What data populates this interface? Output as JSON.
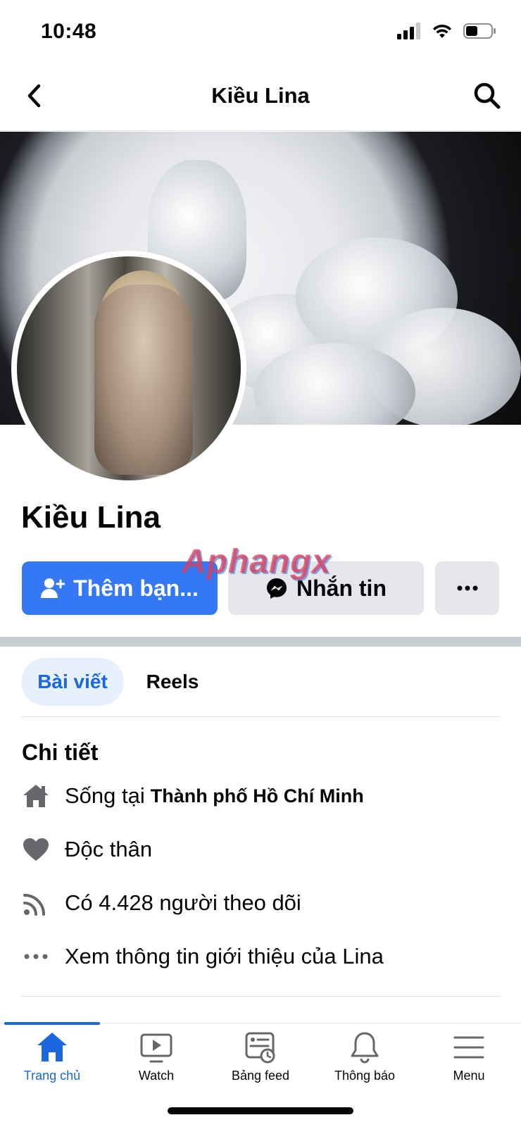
{
  "status_bar": {
    "time": "10:48"
  },
  "nav": {
    "title": "Kiều Lina"
  },
  "profile": {
    "name": "Kiều Lina"
  },
  "actions": {
    "add_friend_label": "Thêm bạn...",
    "message_label": "Nhắn tin",
    "more_label": "···"
  },
  "watermark": "Aphangx",
  "tabs": [
    {
      "label": "Bài viết",
      "active": true
    },
    {
      "label": "Reels",
      "active": false
    }
  ],
  "details": {
    "title": "Chi tiết",
    "lives_prefix": "Sống tại",
    "lives_city": "Thành phố Hồ Chí Minh",
    "relationship": "Độc thân",
    "followers": "Có 4.428 người theo dõi",
    "see_about": "Xem thông tin giới thiệu của Lina"
  },
  "tab_bar": [
    {
      "label": "Trang chủ",
      "icon": "home-icon",
      "active": true
    },
    {
      "label": "Watch",
      "icon": "watch-icon",
      "active": false
    },
    {
      "label": "Bảng feed",
      "icon": "feed-icon",
      "active": false
    },
    {
      "label": "Thông báo",
      "icon": "bell-icon",
      "active": false
    },
    {
      "label": "Menu",
      "icon": "menu-icon",
      "active": false
    }
  ],
  "colors": {
    "accent": "#3478f6",
    "active_tab": "#1b67e0",
    "button_gray": "#e4e6eb"
  }
}
